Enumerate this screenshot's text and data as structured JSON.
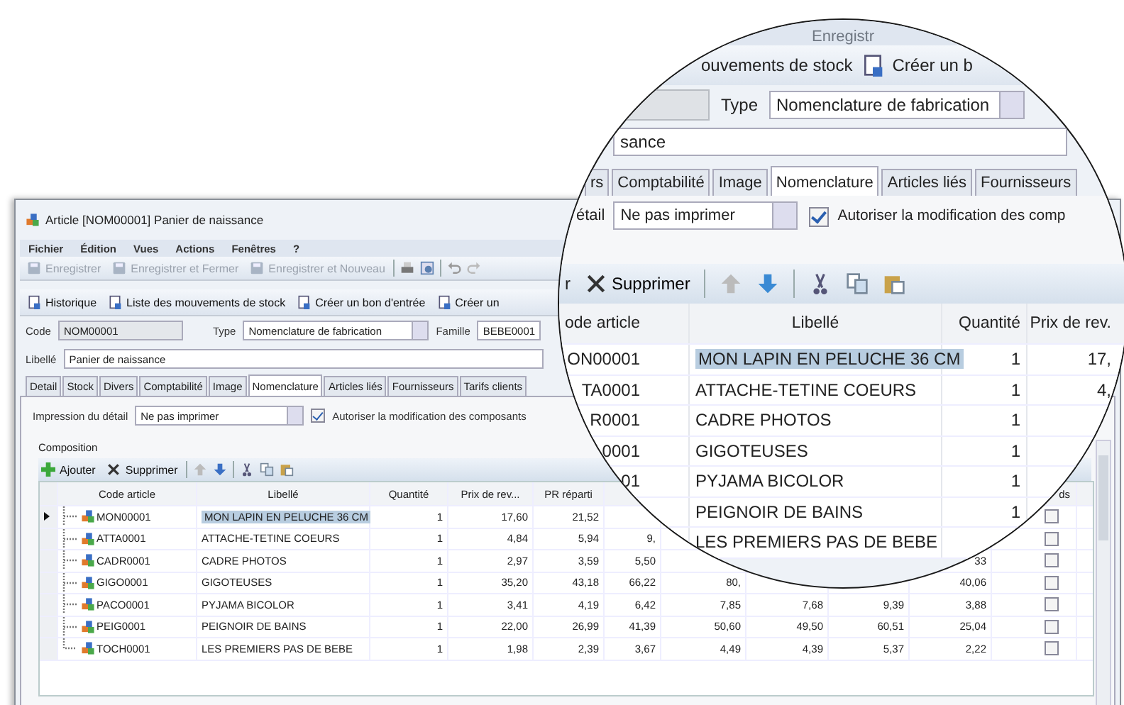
{
  "window": {
    "title": "Article [NOM00001] Panier de naissance"
  },
  "menu": [
    "Fichier",
    "Édition",
    "Vues",
    "Actions",
    "Fenêtres",
    "?"
  ],
  "toolbar": [
    {
      "label": "Enregistrer",
      "disabled": true
    },
    {
      "label": "Enregistrer et Fermer",
      "disabled": true
    },
    {
      "label": "Enregistrer et Nouveau",
      "disabled": true
    }
  ],
  "actions": [
    "Historique",
    "Liste des mouvements de stock",
    "Créer un bon d'entrée",
    "Créer un"
  ],
  "fields": {
    "code": {
      "label": "Code",
      "value": "NOM00001"
    },
    "type": {
      "label": "Type",
      "value": "Nomenclature de fabrication"
    },
    "family": {
      "label": "Famille",
      "value": "BEBE0001"
    },
    "name": {
      "label": "Libellé",
      "value": "Panier de naissance"
    }
  },
  "tabs": [
    {
      "label": "Detail",
      "selected": false
    },
    {
      "label": "Stock",
      "selected": false
    },
    {
      "label": "Divers",
      "selected": false
    },
    {
      "label": "Comptabilité",
      "selected": false
    },
    {
      "label": "Image",
      "selected": false
    },
    {
      "label": "Nomenclature",
      "selected": true
    },
    {
      "label": "Articles liés",
      "selected": false
    },
    {
      "label": "Fournisseurs",
      "selected": false
    },
    {
      "label": "Tarifs clients",
      "selected": false
    }
  ],
  "print_detail": {
    "label": "Impression du détail",
    "value": "Ne pas imprimer"
  },
  "allow_edit": {
    "label": "Autoriser la modification des composants",
    "checked": true
  },
  "composition": {
    "title": "Composition",
    "add": "Ajouter",
    "remove": "Supprimer",
    "columns": [
      "Code article",
      "Libellé",
      "Quantité",
      "Prix de rev...",
      "PR réparti",
      null,
      null,
      null,
      null,
      null,
      "ds"
    ],
    "rows": [
      {
        "selected": true,
        "checked": false,
        "cells": [
          "MON00001",
          "MON LAPIN EN PELUCHE 36 CM",
          "1",
          "17,60",
          "21,52",
          null,
          null,
          null,
          null,
          null
        ]
      },
      {
        "selected": false,
        "checked": false,
        "cells": [
          "ATTA0001",
          "ATTACHE-TETINE COEURS",
          "1",
          "4,84",
          "5,94",
          "9,",
          null,
          null,
          null,
          null
        ]
      },
      {
        "selected": false,
        "checked": false,
        "cells": [
          "CADR0001",
          "CADRE PHOTOS",
          "1",
          "2,97",
          "3,59",
          "5,50",
          null,
          null,
          null,
          "33"
        ]
      },
      {
        "selected": false,
        "checked": false,
        "cells": [
          "GIGO0001",
          "GIGOTEUSES",
          "1",
          "35,20",
          "43,18",
          "66,22",
          "80,",
          null,
          null,
          "40,06"
        ]
      },
      {
        "selected": false,
        "checked": false,
        "cells": [
          "PACO0001",
          "PYJAMA BICOLOR",
          "1",
          "3,41",
          "4,19",
          "6,42",
          "7,85",
          "7,68",
          "9,39",
          "3,88"
        ]
      },
      {
        "selected": false,
        "checked": false,
        "cells": [
          "PEIG0001",
          "PEIGNOIR DE BAINS",
          "1",
          "22,00",
          "26,99",
          "41,39",
          "50,60",
          "49,50",
          "60,51",
          "25,04"
        ]
      },
      {
        "selected": false,
        "checked": false,
        "cells": [
          "TOCH0001",
          "LES PREMIERS PAS DE BEBE",
          "1",
          "1,98",
          "2,39",
          "3,67",
          "4,49",
          "4,39",
          "5,37",
          "2,22"
        ]
      }
    ]
  },
  "magnifier": {
    "top_label": "Enregistr",
    "actions": [
      "ouvements de stock",
      "Créer un b"
    ],
    "type_label": "Type",
    "type_value": "Nomenclature de fabrication",
    "name_value": "sance",
    "tabs": [
      {
        "label": "rs",
        "selected": false
      },
      {
        "label": "Comptabilité",
        "selected": false
      },
      {
        "label": "Image",
        "selected": false
      },
      {
        "label": "Nomenclature",
        "selected": true
      },
      {
        "label": "Articles liés",
        "selected": false
      },
      {
        "label": "Fournisseurs",
        "selected": false
      }
    ],
    "print_label": "étail",
    "print_value": "Ne pas imprimer",
    "allow_edit": {
      "label": "Autoriser la modification des comp",
      "checked": true
    },
    "remove_partial": "r",
    "remove": "Supprimer",
    "columns": [
      "ode article",
      "Libellé",
      "Quantité",
      "Prix de rev."
    ],
    "rows": [
      {
        "selected": true,
        "cells": [
          "ON00001",
          "MON LAPIN EN PELUCHE 36 CM",
          "1",
          "17,"
        ]
      },
      {
        "selected": false,
        "cells": [
          "TA0001",
          "ATTACHE-TETINE COEURS",
          "1",
          "4,"
        ]
      },
      {
        "selected": false,
        "cells": [
          "R0001",
          "CADRE PHOTOS",
          "1",
          null
        ]
      },
      {
        "selected": false,
        "cells": [
          "0001",
          "GIGOTEUSES",
          "1",
          null
        ]
      },
      {
        "selected": false,
        "cells": [
          "01",
          "PYJAMA BICOLOR",
          "1",
          null
        ]
      },
      {
        "selected": false,
        "cells": [
          null,
          "PEIGNOIR DE BAINS",
          "1",
          null
        ]
      },
      {
        "selected": false,
        "cells": [
          null,
          "LES PREMIERS PAS DE BEBE",
          null,
          null
        ]
      }
    ]
  }
}
